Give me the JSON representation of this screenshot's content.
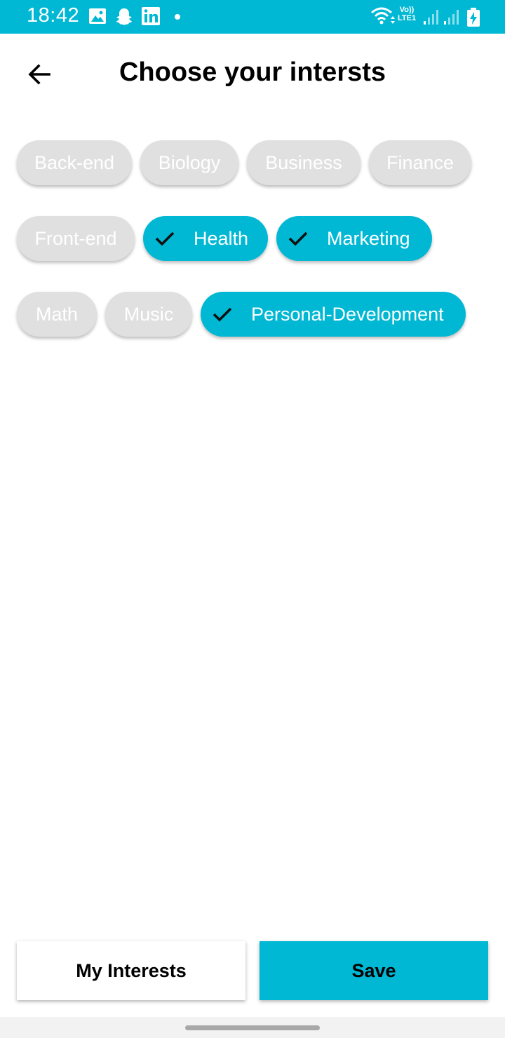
{
  "status_bar": {
    "time": "18:42",
    "network_top": "Vo))",
    "network_bottom": "LTE1",
    "icons": [
      "gallery-icon",
      "snapchat-icon",
      "linkedin-icon",
      "dot-icon",
      "wifi-icon",
      "signal-icon",
      "signal-icon",
      "battery-charging-icon"
    ]
  },
  "header": {
    "back_icon": "arrow-left-icon",
    "title": "Choose your intersts"
  },
  "chips": [
    {
      "label": "Back-end",
      "selected": false
    },
    {
      "label": "Biology",
      "selected": false
    },
    {
      "label": "Business",
      "selected": false
    },
    {
      "label": "Finance",
      "selected": false
    },
    {
      "label": "Front-end",
      "selected": false
    },
    {
      "label": "Health",
      "selected": true
    },
    {
      "label": "Marketing",
      "selected": true
    },
    {
      "label": "Math",
      "selected": false
    },
    {
      "label": "Music",
      "selected": false
    },
    {
      "label": "Personal-Development",
      "selected": true
    }
  ],
  "actions": {
    "my_interests_label": "My Interests",
    "save_label": "Save"
  },
  "colors": {
    "accent": "#00b8d4",
    "chip_unselected": "#e0e0e0",
    "chip_text": "#ffffff"
  }
}
